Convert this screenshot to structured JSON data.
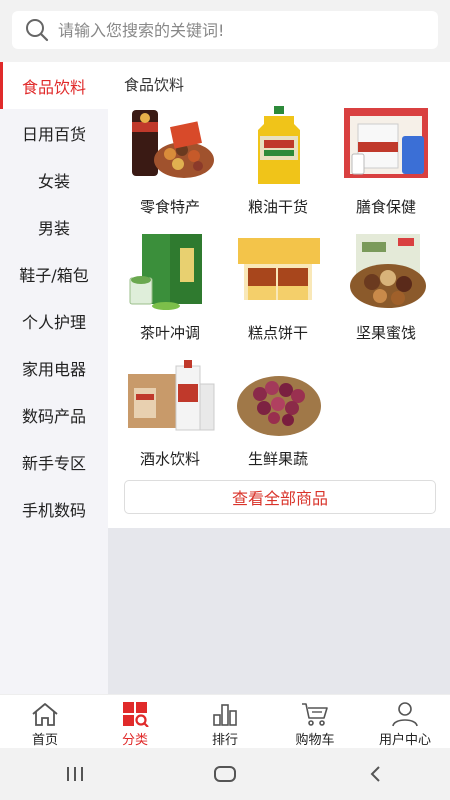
{
  "search": {
    "placeholder": "请输入您搜索的关键词!"
  },
  "sidebar": {
    "items": [
      {
        "label": "食品饮料"
      },
      {
        "label": "日用百货"
      },
      {
        "label": "女装"
      },
      {
        "label": "男装"
      },
      {
        "label": "鞋子/箱包"
      },
      {
        "label": "个人护理"
      },
      {
        "label": "家用电器"
      },
      {
        "label": "数码产品"
      },
      {
        "label": "新手专区"
      },
      {
        "label": "手机数码"
      }
    ]
  },
  "main": {
    "title": "食品饮料",
    "categories": [
      {
        "label": "零食特产"
      },
      {
        "label": "粮油干货"
      },
      {
        "label": "膳食保健"
      },
      {
        "label": "茶叶冲调"
      },
      {
        "label": "糕点饼干"
      },
      {
        "label": "坚果蜜饯"
      },
      {
        "label": "酒水饮料"
      },
      {
        "label": "生鲜果蔬"
      }
    ],
    "view_all": "查看全部商品"
  },
  "tabbar": {
    "tabs": [
      {
        "label": "首页"
      },
      {
        "label": "分类"
      },
      {
        "label": "排行"
      },
      {
        "label": "购物车"
      },
      {
        "label": "用户中心"
      }
    ]
  },
  "colors": {
    "accent": "#e02a2a",
    "background": "#f3f3f7"
  },
  "icons": [
    "search-icon",
    "home-icon",
    "category-icon",
    "ranking-icon",
    "cart-icon",
    "user-icon",
    "recents-icon",
    "home-nav-icon",
    "back-icon"
  ]
}
